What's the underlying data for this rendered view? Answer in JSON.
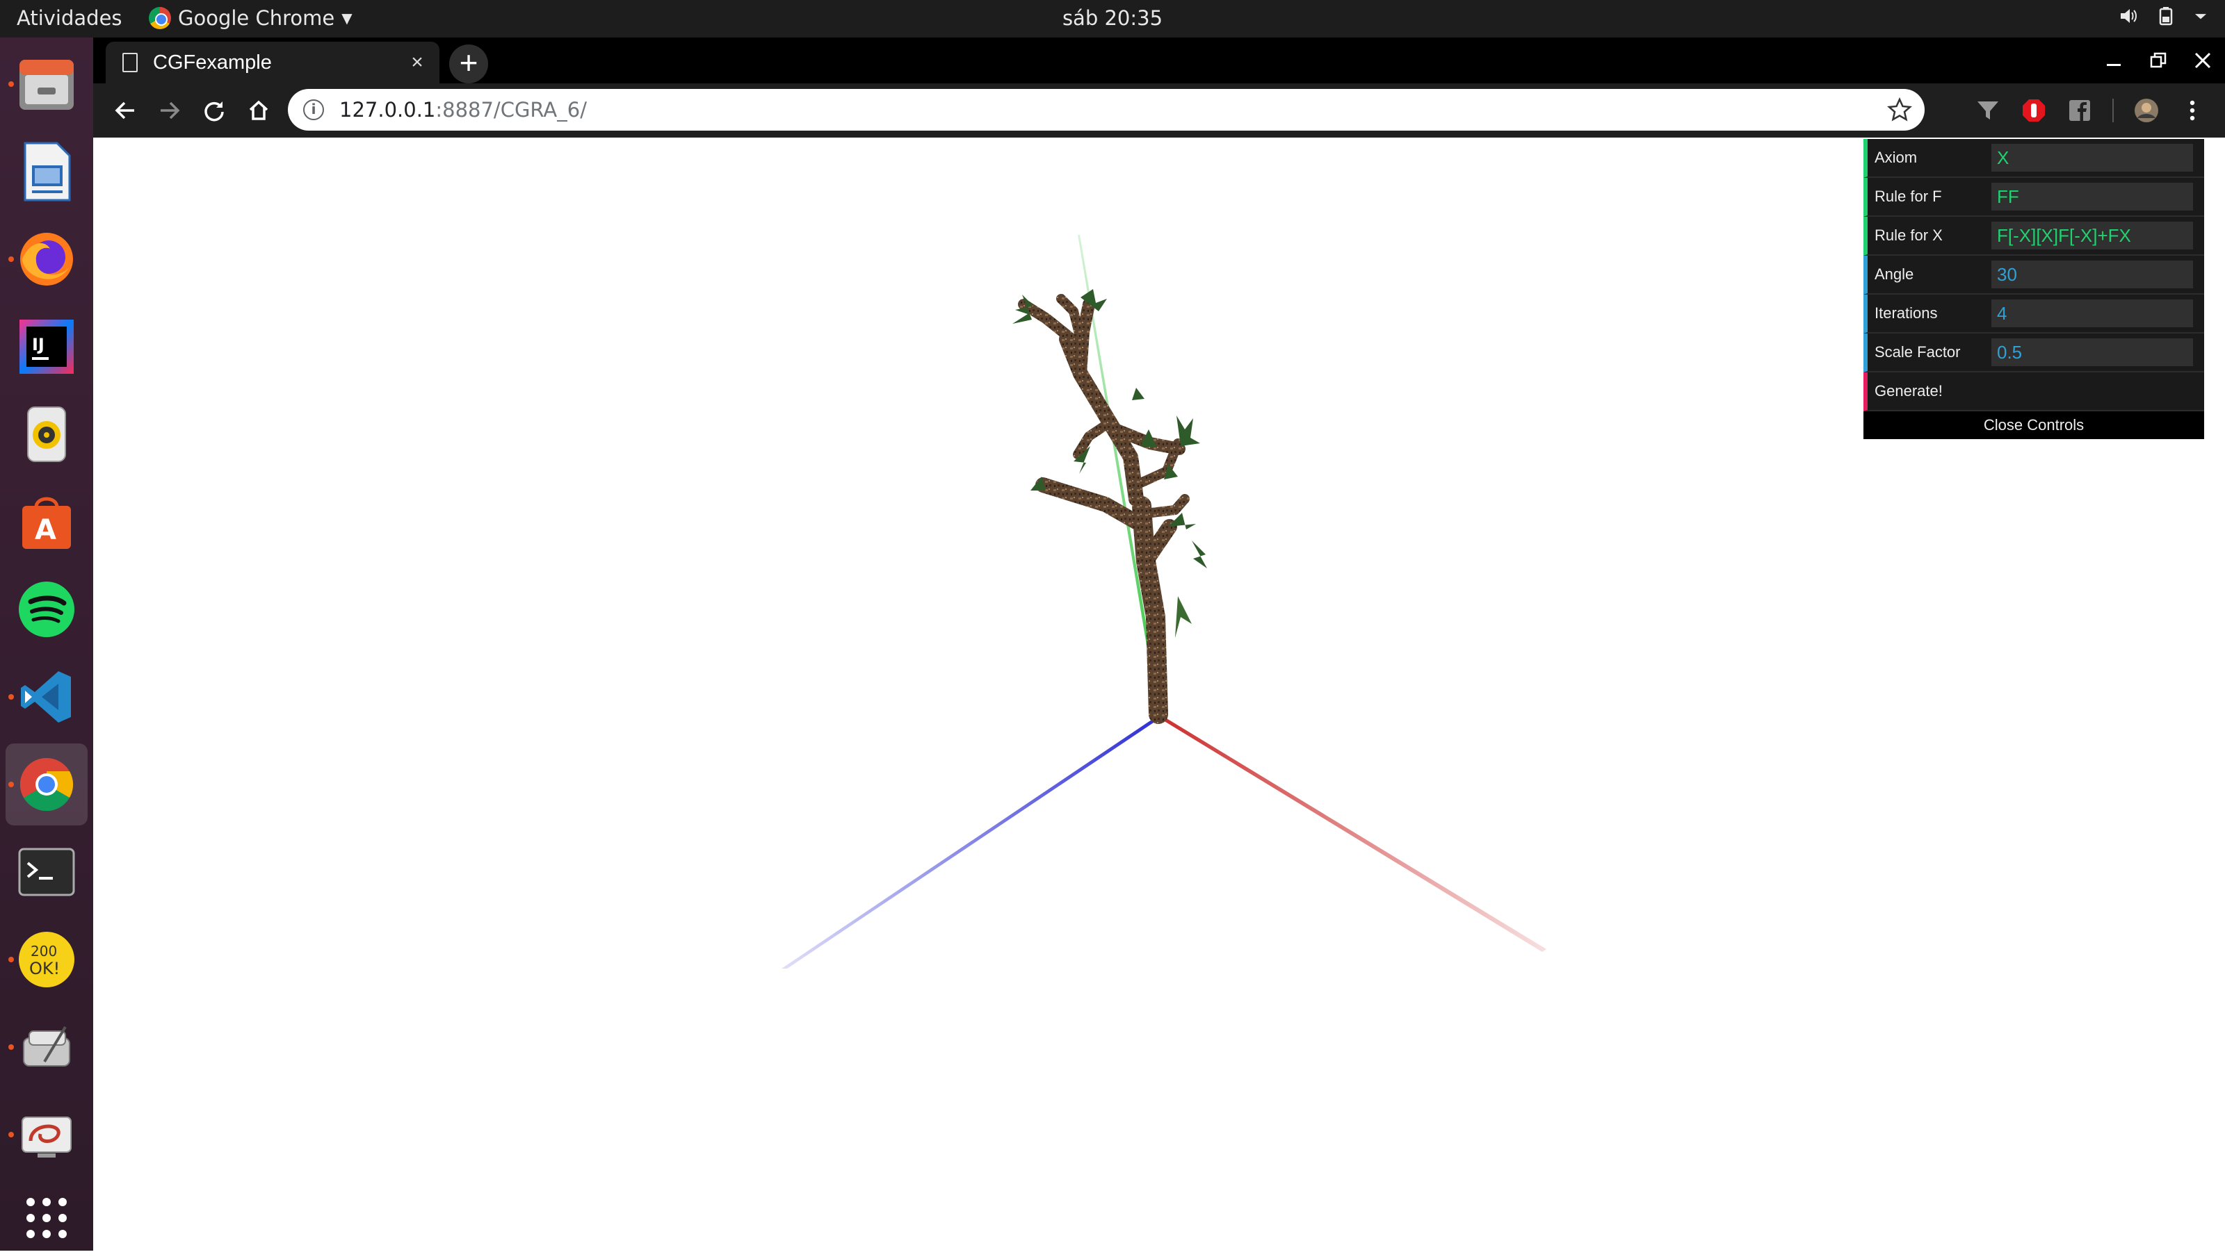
{
  "topbar": {
    "activities": "Atividades",
    "app_name": "Google Chrome",
    "clock": "sáb 20:35"
  },
  "dock": {
    "items": [
      {
        "name": "files",
        "running": true,
        "active": false
      },
      {
        "name": "libreoffice-impress",
        "running": false,
        "active": false
      },
      {
        "name": "firefox",
        "running": true,
        "active": false
      },
      {
        "name": "intellij-idea",
        "running": false,
        "active": false
      },
      {
        "name": "rhythmbox",
        "running": false,
        "active": false
      },
      {
        "name": "ubuntu-software",
        "running": false,
        "active": false
      },
      {
        "name": "spotify",
        "running": false,
        "active": false
      },
      {
        "name": "vscode",
        "running": true,
        "active": false
      },
      {
        "name": "chrome",
        "running": true,
        "active": true
      },
      {
        "name": "terminal",
        "running": false,
        "active": false
      },
      {
        "name": "postman-200ok",
        "running": true,
        "active": false
      },
      {
        "name": "disk-utility",
        "running": true,
        "active": false
      },
      {
        "name": "remmina",
        "running": true,
        "active": false
      },
      {
        "name": "show-applications",
        "running": false,
        "active": false
      }
    ]
  },
  "browser": {
    "tab_title": "CGFexample",
    "url_host": "127.0.0.1",
    "url_rest": ":8887/CGRA_6/"
  },
  "gui": {
    "rows": [
      {
        "label": "Axiom",
        "value": "X",
        "type": "string"
      },
      {
        "label": "Rule for F",
        "value": "FF",
        "type": "string"
      },
      {
        "label": "Rule for X",
        "value": "F[-X][X]F[-X]+FX",
        "type": "string"
      },
      {
        "label": "Angle",
        "value": "30",
        "type": "number"
      },
      {
        "label": "Iterations",
        "value": "4",
        "type": "number"
      },
      {
        "label": "Scale Factor",
        "value": "0.5",
        "type": "number"
      }
    ],
    "generate_label": "Generate!",
    "close_label": "Close Controls"
  },
  "colors": {
    "axis_x": "#d0383b",
    "axis_y": "#39c44a",
    "axis_z": "#3838d8",
    "bark": "#5b4330",
    "leaf": "#2f5a2a"
  }
}
